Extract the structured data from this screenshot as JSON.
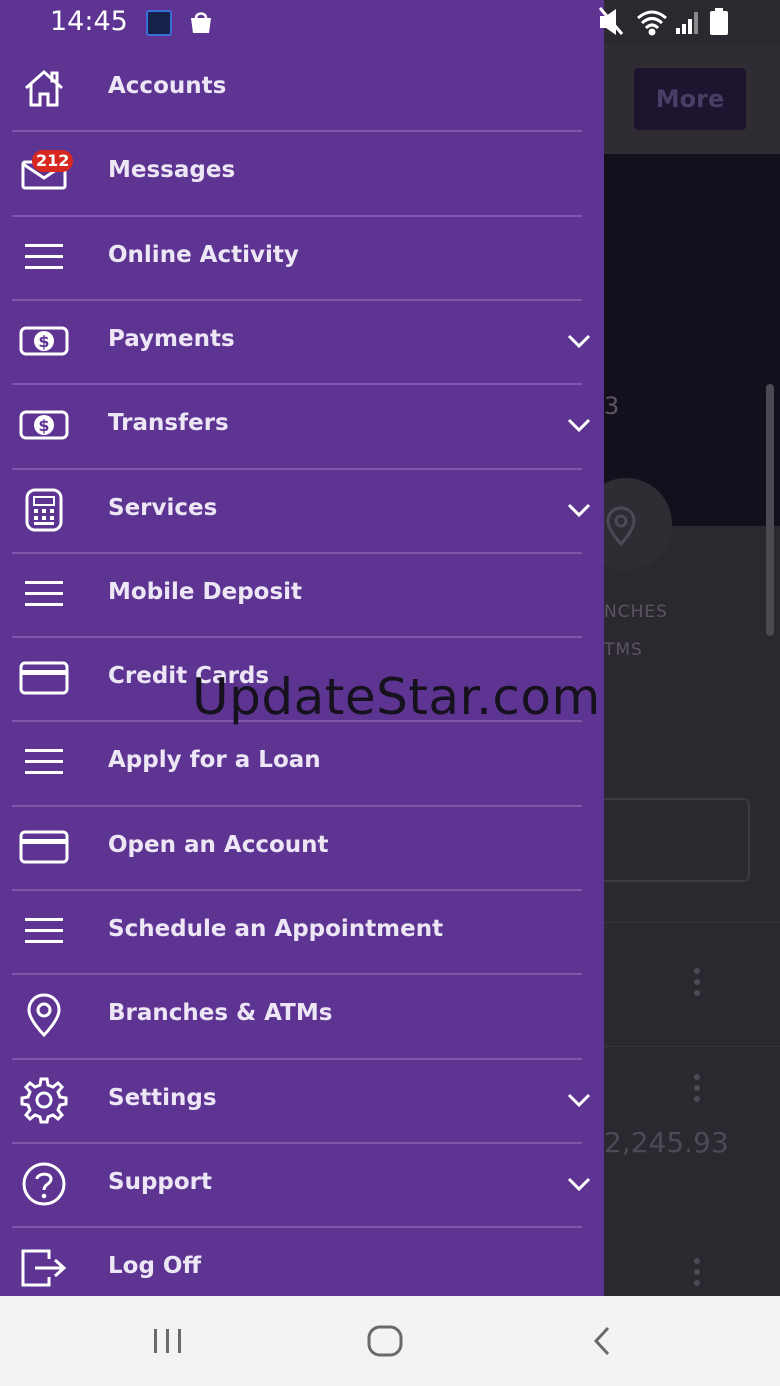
{
  "status_bar": {
    "time": "14:45"
  },
  "drawer": {
    "items": [
      {
        "label": "Accounts",
        "icon": "home-icon",
        "expandable": false
      },
      {
        "label": "Messages",
        "icon": "envelope-icon",
        "badge": "212",
        "expandable": false
      },
      {
        "label": "Online Activity",
        "icon": "menu-lines-icon",
        "expandable": false
      },
      {
        "label": "Payments",
        "icon": "dollar-bill-icon",
        "expandable": true
      },
      {
        "label": "Transfers",
        "icon": "dollar-bill-icon",
        "expandable": true
      },
      {
        "label": "Services",
        "icon": "calculator-icon",
        "expandable": true
      },
      {
        "label": "Mobile Deposit",
        "icon": "menu-lines-icon",
        "expandable": false
      },
      {
        "label": "Credit Cards",
        "icon": "credit-card-icon",
        "expandable": false
      },
      {
        "label": "Apply for a Loan",
        "icon": "menu-lines-icon",
        "expandable": false
      },
      {
        "label": "Open an Account",
        "icon": "credit-card-icon",
        "expandable": false
      },
      {
        "label": "Schedule an Appointment",
        "icon": "menu-lines-icon",
        "expandable": false
      },
      {
        "label": "Branches & ATMs",
        "icon": "location-pin-icon",
        "expandable": false
      },
      {
        "label": "Settings",
        "icon": "gear-icon",
        "expandable": true
      },
      {
        "label": "Support",
        "icon": "question-circle-icon",
        "expandable": true
      },
      {
        "label": "Log Off",
        "icon": "logout-icon",
        "expandable": false
      }
    ]
  },
  "background": {
    "more_button": "More",
    "hero_text": "3",
    "label_line1": "NCHES",
    "label_line2": "TMS",
    "amount": "2,245.93"
  },
  "watermark": "UpdateStar.com",
  "colors": {
    "drawer": "#5e3493",
    "badge": "#d8271f",
    "navbar": "#f3f3f5"
  }
}
